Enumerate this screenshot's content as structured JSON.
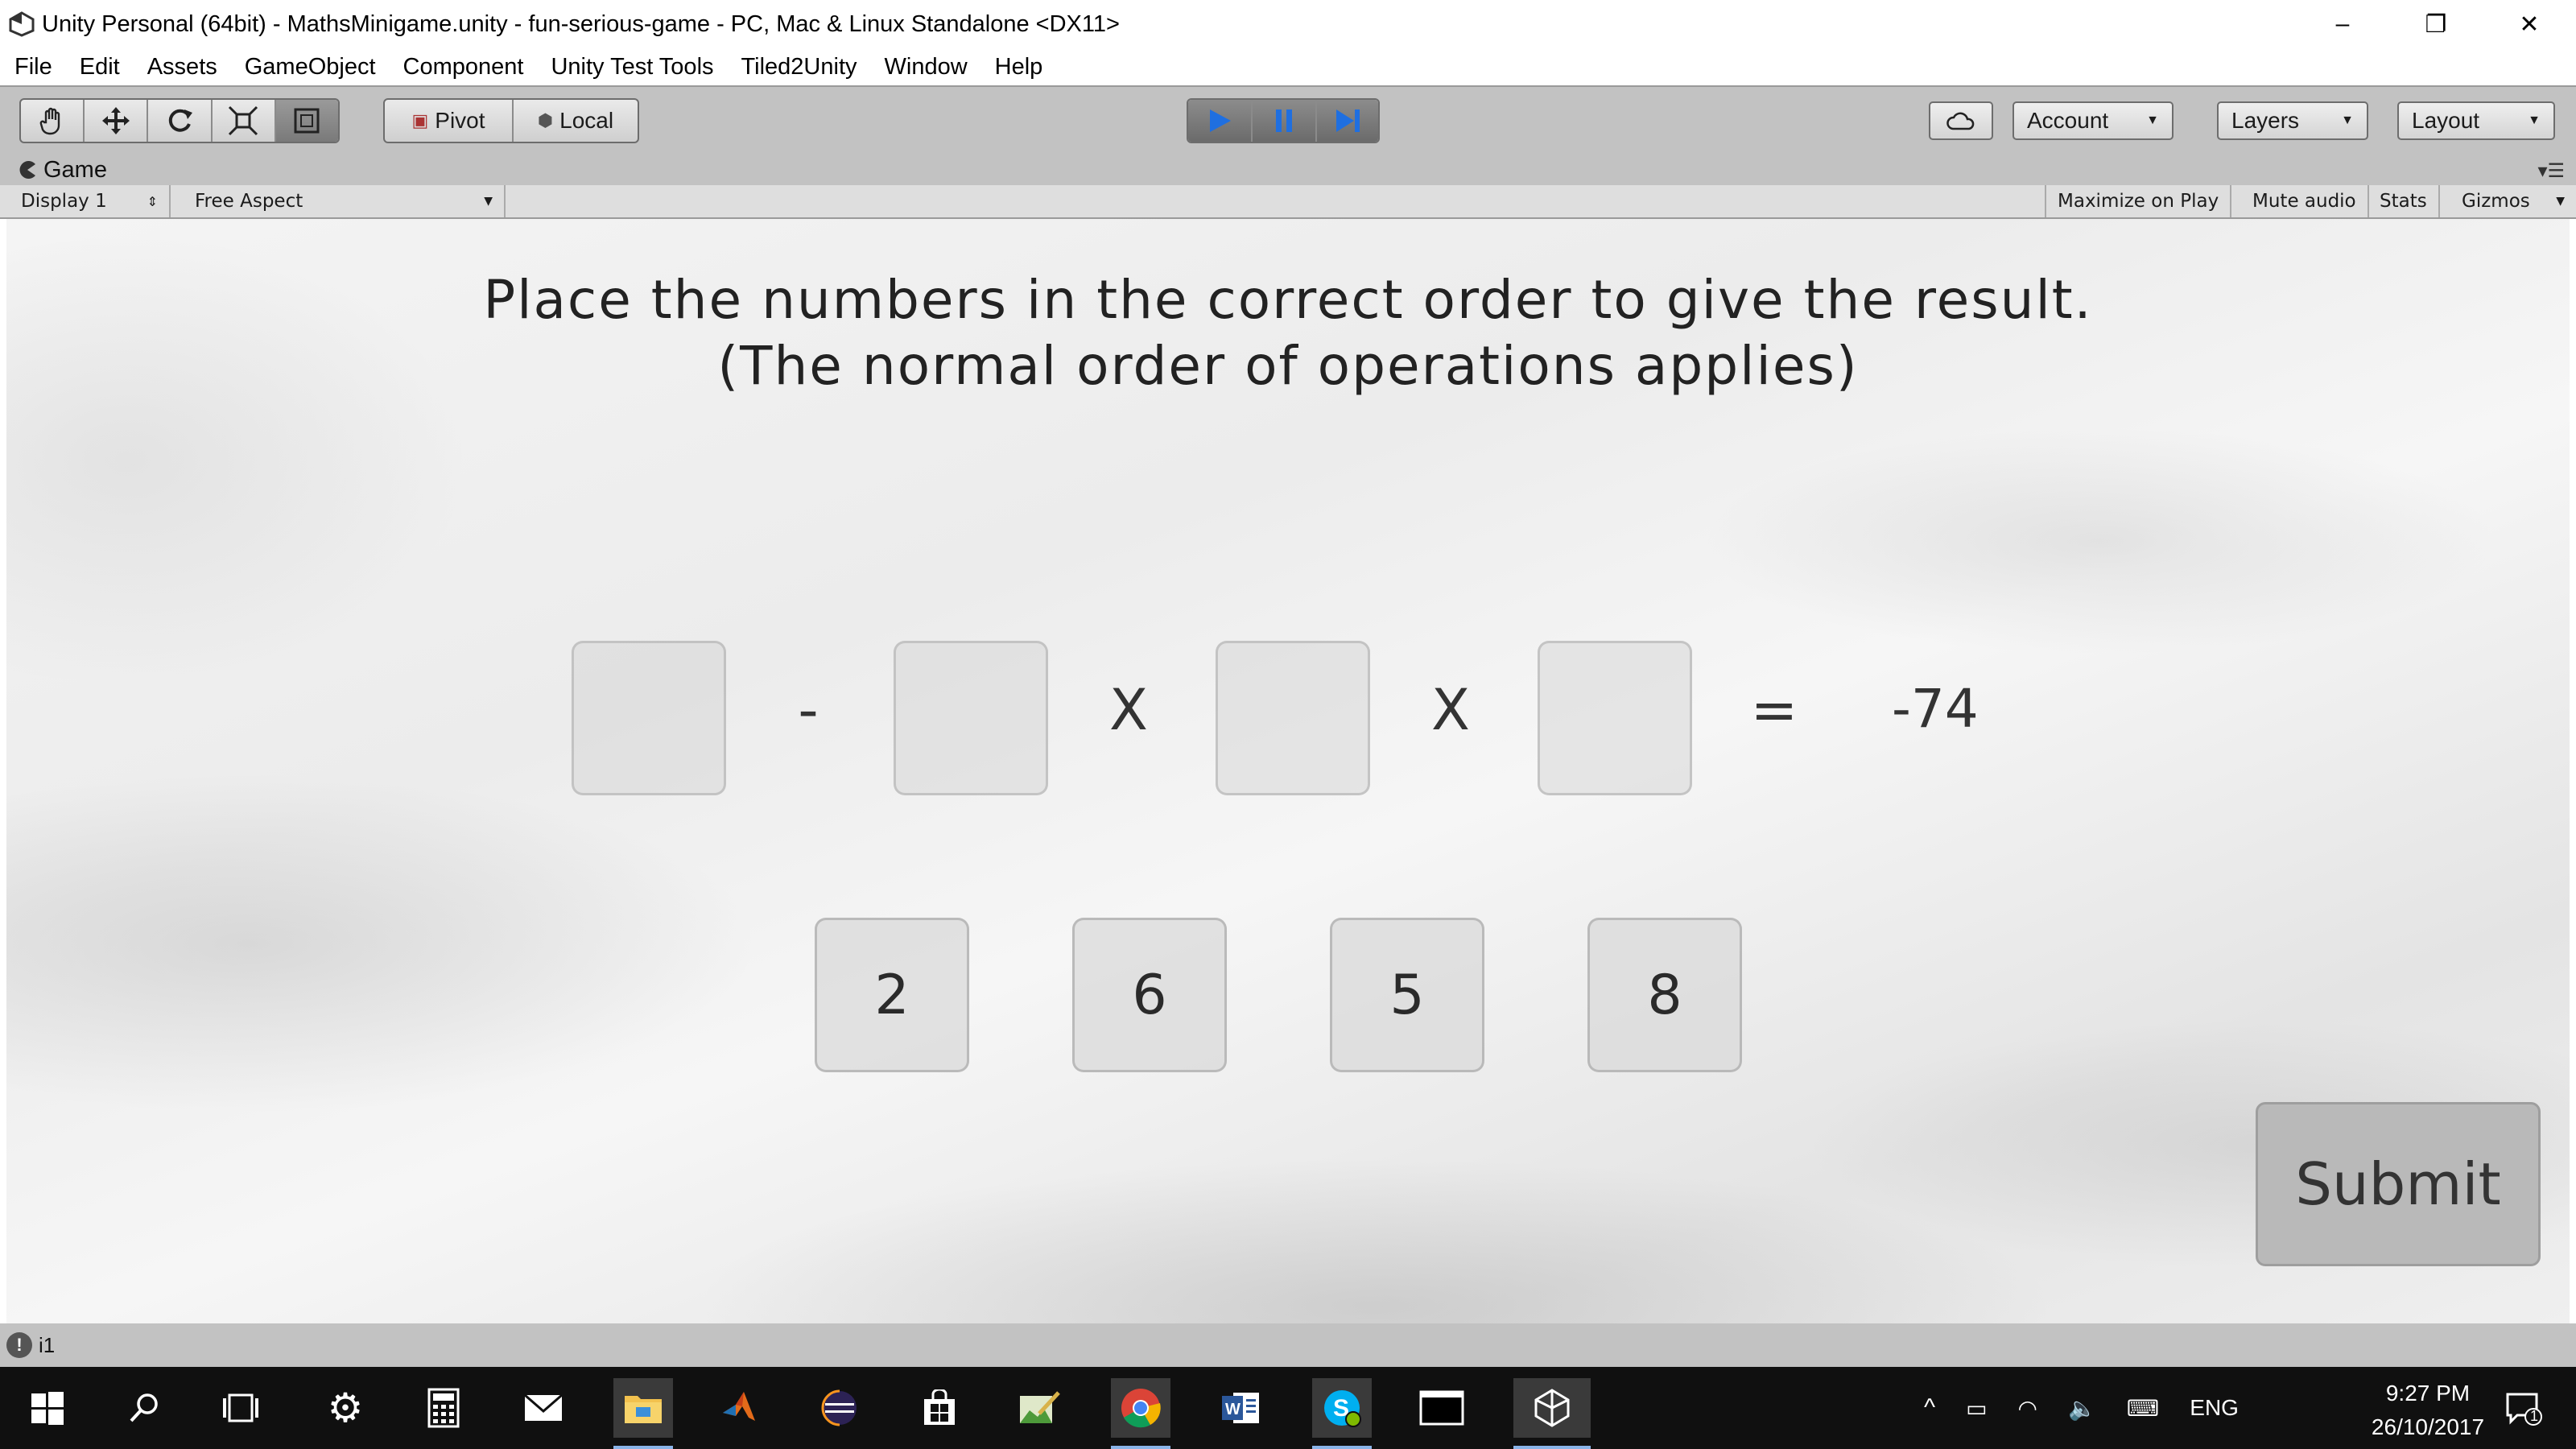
{
  "window": {
    "title": "Unity Personal (64bit) - MathsMinigame.unity - fun-serious-game - PC, Mac & Linux Standalone <DX11>",
    "minimize": "–",
    "restore": "❐",
    "close": "✕"
  },
  "menu": [
    "File",
    "Edit",
    "Assets",
    "GameObject",
    "Component",
    "Unity Test Tools",
    "Tiled2Unity",
    "Window",
    "Help"
  ],
  "toolbar": {
    "pivot": "Pivot",
    "local": "Local",
    "account": "Account",
    "layers": "Layers",
    "layout": "Layout"
  },
  "game_tab": {
    "label": "Game",
    "display": "Display 1",
    "aspect": "Free Aspect",
    "maximize_on_play": "Maximize on Play",
    "mute_audio": "Mute audio",
    "stats": "Stats",
    "gizmos": "Gizmos"
  },
  "game": {
    "instruction_line1": "Place the numbers in the correct order to give the result.",
    "instruction_line2": "(The normal order of operations applies)",
    "operators": [
      "-",
      "X",
      "X",
      "="
    ],
    "result": "-74",
    "tiles": [
      "2",
      "6",
      "5",
      "8"
    ],
    "submit": "Submit"
  },
  "status": {
    "text": "i1"
  },
  "taskbar": {
    "language": "ENG",
    "time": "9:27 PM",
    "date": "26/10/2017",
    "notification_count": "1"
  }
}
